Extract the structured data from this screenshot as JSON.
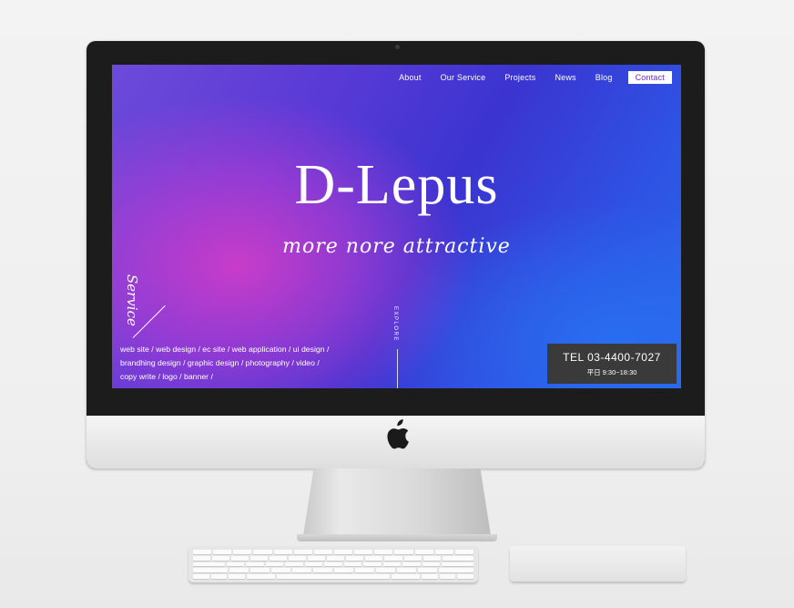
{
  "nav": {
    "items": [
      "About",
      "Our Service",
      "Projects",
      "News",
      "Blog"
    ],
    "contact": "Contact"
  },
  "hero": {
    "title": "D-Lepus",
    "subtitle": "more nore attractive"
  },
  "service": {
    "label": "Service",
    "list": "web site / web design / ec site / web application / ui design / brandhing design / graphic design / photography / video / copy write / logo / banner /"
  },
  "explore": "EXPLORE",
  "contact_box": {
    "tel": "TEL 03-4400-7027",
    "hours": "平日 9:30~18:30"
  },
  "colors": {
    "contact_text": "#6a2ad0",
    "tel_box_bg": "#3a3a3a",
    "gradient_pink": "#ce3cc8",
    "gradient_blue": "#2a66ea"
  },
  "icons": [
    "apple-logo-icon"
  ]
}
